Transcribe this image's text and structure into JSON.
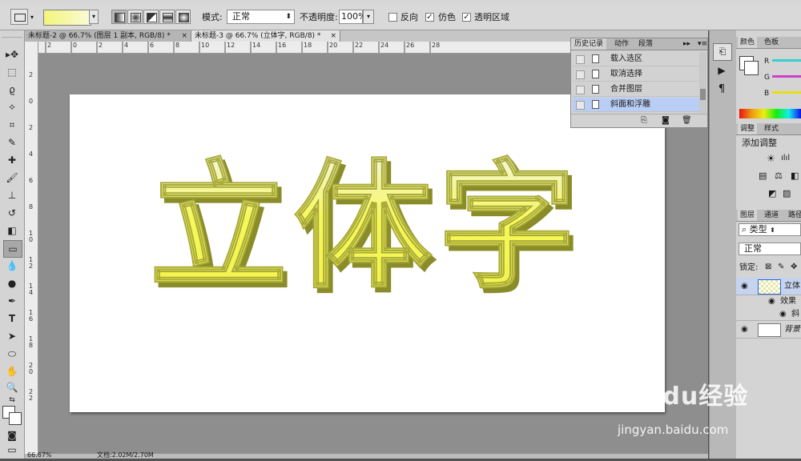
{
  "options_bar": {
    "mode_label": "模式:",
    "mode_value": "正常",
    "opacity_label": "不透明度:",
    "opacity_value": "100%",
    "reverse_label": "反向",
    "dither_label": "仿色",
    "transparency_label": "透明区域",
    "dither_checked": true,
    "transparency_checked": true,
    "gradient_color": "#f2f57a"
  },
  "doc_tabs": [
    {
      "label": "未标题-2 @ 66.7% (图层 1 副本, RGB/8) *"
    },
    {
      "label": "未标题-3 @ 66.7% (立体字, RGB/8) *"
    }
  ],
  "ruler_labels": [
    "2",
    "0",
    "2",
    "4",
    "6",
    "8",
    "10",
    "12",
    "14",
    "16",
    "18",
    "20",
    "22",
    "24",
    "26",
    "28"
  ],
  "vruler_labels": [
    "2",
    "0",
    "2",
    "4",
    "6",
    "8",
    "1 0",
    "1 2",
    "1 4",
    "1 6",
    "1 8",
    "2 0",
    "2 2"
  ],
  "canvas_text": "立体字",
  "history_panel": {
    "tabs": [
      "历史记录",
      "动作",
      "段落"
    ],
    "items": [
      {
        "label": "载入选区"
      },
      {
        "label": "取消选择"
      },
      {
        "label": "合并图层"
      },
      {
        "label": "斜面和浮雕"
      }
    ],
    "selected_index": 3
  },
  "color_panel": {
    "tabs": [
      "颜色",
      "色板"
    ],
    "channels": [
      "R",
      "G",
      "B"
    ],
    "channel_colors": [
      "#36d0d0",
      "#d040c8",
      "#e6e010"
    ]
  },
  "adjust_panel": {
    "tabs": [
      "调整",
      "样式"
    ],
    "title": "添加调整"
  },
  "layers_panel": {
    "tabs": [
      "图层",
      "通道",
      "路径"
    ],
    "filter": "类型",
    "blend": "正常",
    "lock_label": "锁定:",
    "layers": [
      {
        "name": "立体"
      },
      {
        "name": "效果"
      },
      {
        "name": "斜"
      },
      {
        "name": "背景"
      }
    ]
  },
  "status": {
    "zoom": "66.67%",
    "doc_info": "文档:2.02M/2.70M"
  },
  "watermark": {
    "logo": "Baidu经验",
    "url": "jingyan.baidu.com"
  }
}
